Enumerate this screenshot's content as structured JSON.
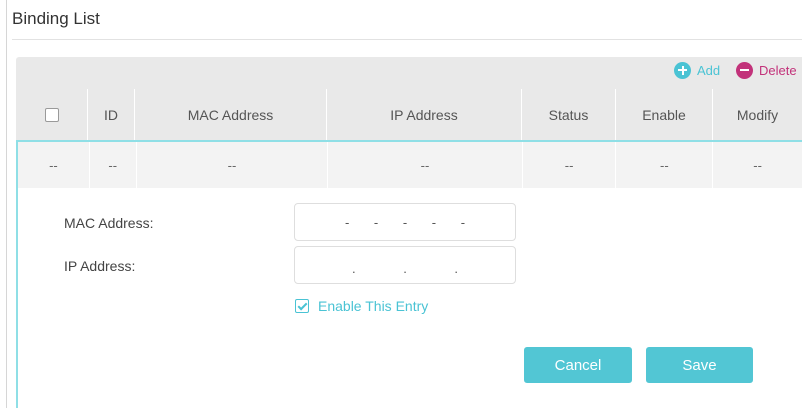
{
  "section": {
    "title": "Binding List"
  },
  "toolbar": {
    "add_label": "Add",
    "delete_label": "Delete"
  },
  "table": {
    "columns": [
      "ID",
      "MAC Address",
      "IP Address",
      "Status",
      "Enable",
      "Modify"
    ],
    "row": [
      "--",
      "--",
      "--",
      "--",
      "--",
      "--",
      "--"
    ]
  },
  "form": {
    "mac_label": "MAC Address:",
    "mac_value": "- - - - -",
    "ip_label": "IP Address:",
    "ip_value": ". . .",
    "enable_label": "Enable This Entry",
    "enable_checked": true,
    "cancel_label": "Cancel",
    "save_label": "Save"
  },
  "colors": {
    "accent": "#4ac3d4",
    "delete": "#c2327a",
    "header_bg": "#e9e9e9"
  }
}
